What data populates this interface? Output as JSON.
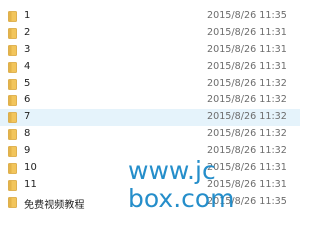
{
  "files": [
    {
      "name": "1",
      "date": "2015/8/26 11:35",
      "icon": "folder-icon",
      "selected": false
    },
    {
      "name": "2",
      "date": "2015/8/26 11:31",
      "icon": "folder-icon",
      "selected": false
    },
    {
      "name": "3",
      "date": "2015/8/26 11:31",
      "icon": "folder-icon",
      "selected": false
    },
    {
      "name": "4",
      "date": "2015/8/26 11:31",
      "icon": "folder-icon",
      "selected": false
    },
    {
      "name": "5",
      "date": "2015/8/26 11:32",
      "icon": "folder-icon",
      "selected": false
    },
    {
      "name": "6",
      "date": "2015/8/26 11:32",
      "icon": "folder-icon",
      "selected": false
    },
    {
      "name": "7",
      "date": "2015/8/26 11:32",
      "icon": "folder-icon",
      "selected": true
    },
    {
      "name": "8",
      "date": "2015/8/26 11:32",
      "icon": "folder-icon",
      "selected": false
    },
    {
      "name": "9",
      "date": "2015/8/26 11:32",
      "icon": "folder-icon",
      "selected": false
    },
    {
      "name": "10",
      "date": "2015/8/26 11:31",
      "icon": "folder-icon",
      "selected": false
    },
    {
      "name": "11",
      "date": "2015/8/26 11:31",
      "icon": "folder-icon",
      "selected": false
    },
    {
      "name": "免费视频教程",
      "date": "2015/8/26 11:35",
      "icon": "folder-icon",
      "selected": false
    }
  ],
  "watermark": {
    "line1": "www.jc",
    "line2": "box.com"
  },
  "colors": {
    "folder_fill": "#f2c55c",
    "folder_dark": "#d9a53a",
    "selected_row": "#e5f3fb",
    "watermark": "#1a88c8"
  }
}
